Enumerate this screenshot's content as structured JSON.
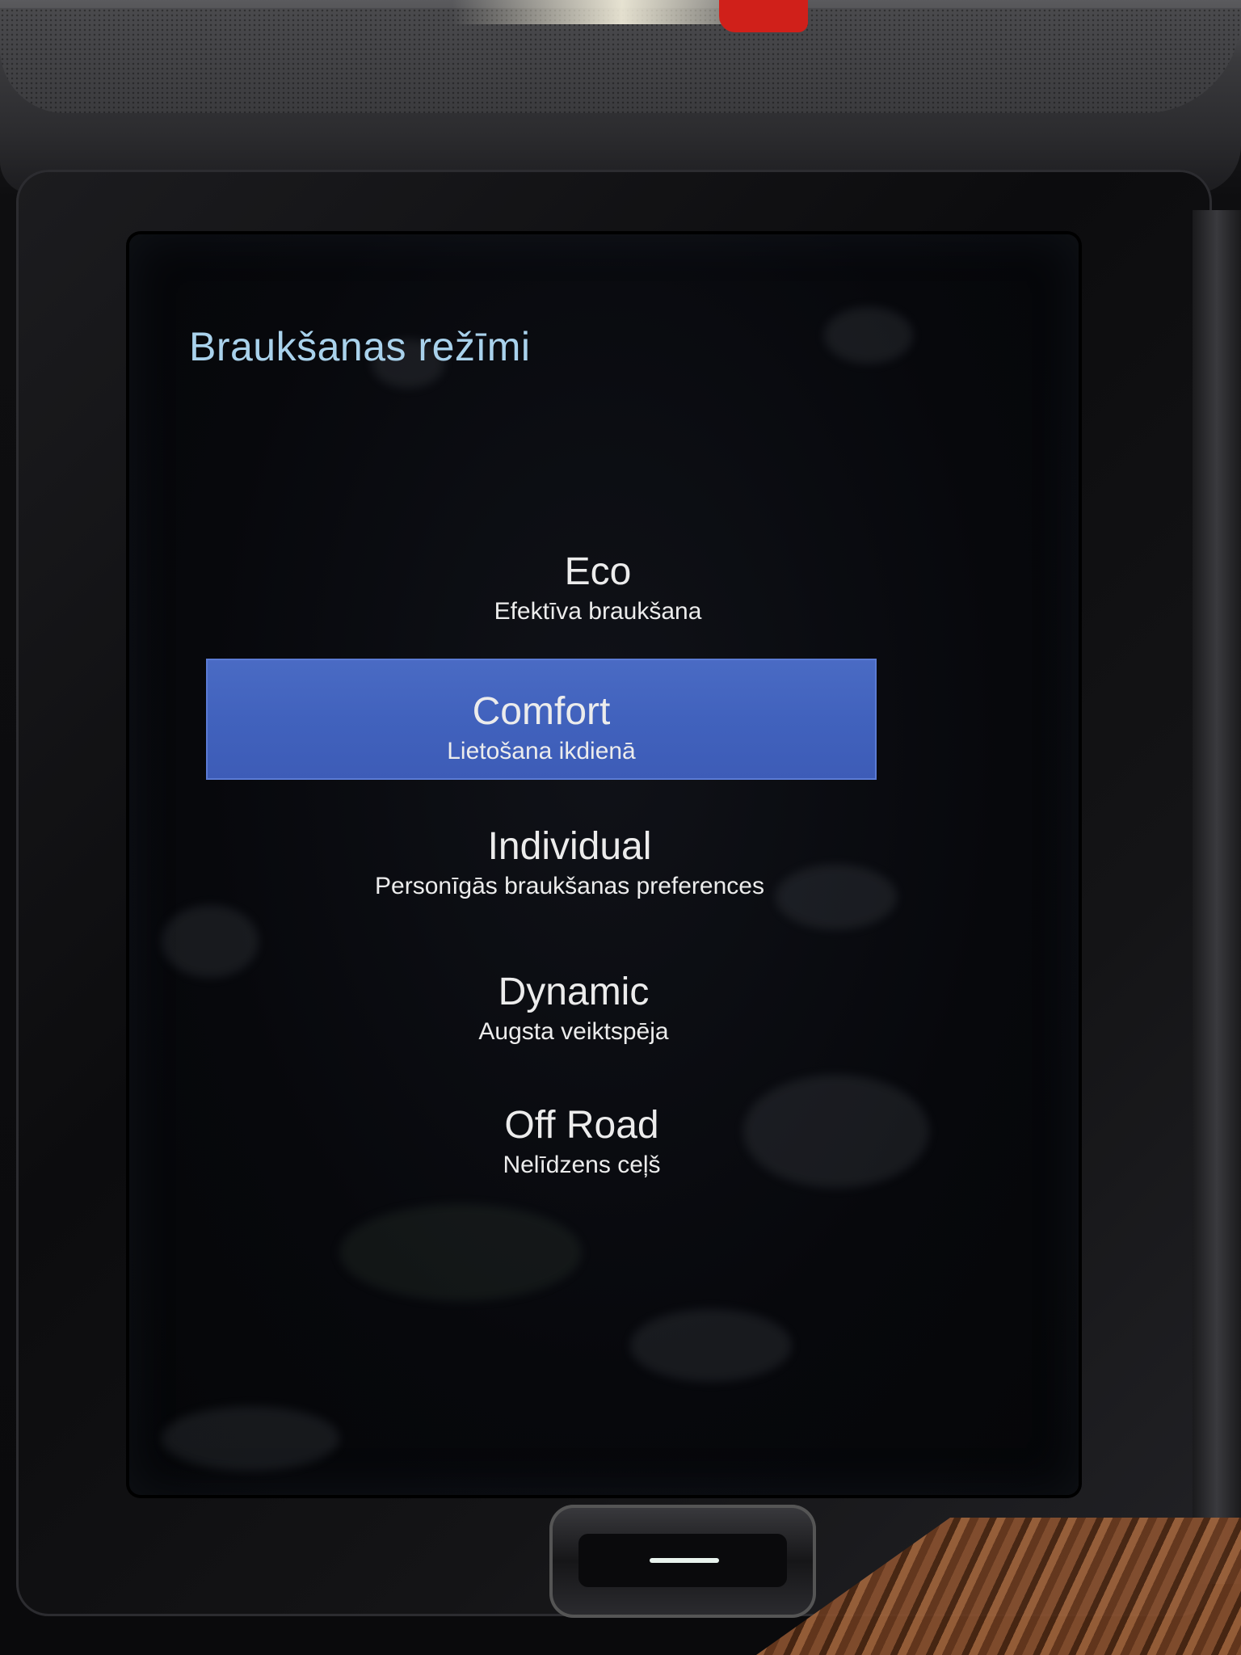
{
  "screen": {
    "title": "Braukšanas režīmi"
  },
  "modes": [
    {
      "name": "Eco",
      "description": "Efektīva braukšana",
      "selected": false
    },
    {
      "name": "Comfort",
      "description": "Lietošana ikdienā",
      "selected": true
    },
    {
      "name": "Individual",
      "description": "Personīgās braukšanas preferences",
      "selected": false
    },
    {
      "name": "Dynamic",
      "description": "Augsta veiktspēja",
      "selected": false
    },
    {
      "name": "Off Road",
      "description": "Nelīdzens ceļš",
      "selected": false
    }
  ],
  "colors": {
    "title": "#a9d2ec",
    "selection_highlight": "#4162bd",
    "text": "#ececec",
    "background": "#07080c"
  },
  "icons": {
    "home_button": "home-bar-icon"
  }
}
